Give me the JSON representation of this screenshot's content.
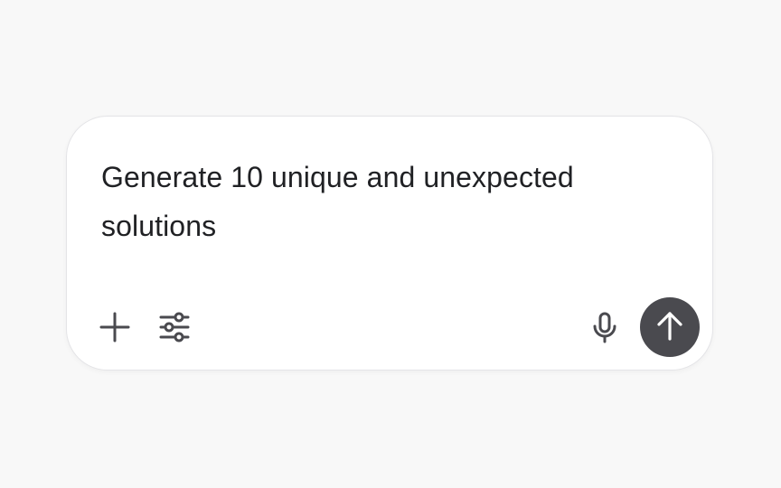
{
  "composer": {
    "prompt_text": "Generate 10 unique and unexpected solutions",
    "icons": {
      "add": "plus-icon",
      "tools": "sliders-icon",
      "voice": "microphone-icon",
      "send": "arrow-up-icon"
    },
    "colors": {
      "page_background": "#f8f8f8",
      "card_background": "#ffffff",
      "text": "#202124",
      "icon": "#4a4a4f",
      "send_button": "#4a4a4f"
    }
  }
}
